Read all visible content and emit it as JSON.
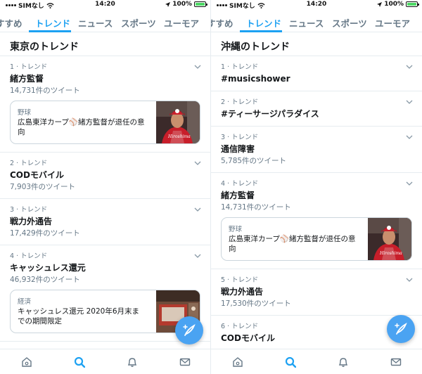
{
  "accent_color": "#1da1f2",
  "left": {
    "status": {
      "carrier": "SIMなし",
      "time": "14:20",
      "battery": "100%",
      "battery_level": 1.0
    },
    "tabs": [
      {
        "label": "すすめ",
        "active": false
      },
      {
        "label": "トレンド",
        "active": true
      },
      {
        "label": "ニュース",
        "active": false
      },
      {
        "label": "スポーツ",
        "active": false
      },
      {
        "label": "ユーモア",
        "active": false
      }
    ],
    "section_title": "東京のトレンド",
    "trends": [
      {
        "rank": "1 · トレンド",
        "name": "緒方監督",
        "count": "14,731件のツイート",
        "card": {
          "category": "野球",
          "text": "広島東洋カープ⚾️緒方監督が退任の意向"
        }
      },
      {
        "rank": "2 · トレンド",
        "name": "CODモバイル",
        "count": "7,903件のツイート"
      },
      {
        "rank": "3 · トレンド",
        "name": "戦力外通告",
        "count": "17,429件のツイート"
      },
      {
        "rank": "4 · トレンド",
        "name": "キャッシュレス還元",
        "count": "46,932件のツイート",
        "card": {
          "category": "経済",
          "text": "キャッシュレス還元 2020年6月末までの期間限定"
        }
      }
    ],
    "icons": [
      "home-icon",
      "search-icon",
      "bell-icon",
      "mail-icon",
      "compose-tweet-icon",
      "chevron-down-icon"
    ]
  },
  "right": {
    "status": {
      "carrier": "SIMなし",
      "time": "14:20",
      "battery": "100%",
      "battery_level": 1.0
    },
    "tabs": [
      {
        "label": "すすめ",
        "active": false
      },
      {
        "label": "トレンド",
        "active": true
      },
      {
        "label": "ニュース",
        "active": false
      },
      {
        "label": "スポーツ",
        "active": false
      },
      {
        "label": "ユーモア",
        "active": false
      }
    ],
    "section_title": "沖縄のトレンド",
    "trends": [
      {
        "rank": "1 · トレンド",
        "name": "#musicshower"
      },
      {
        "rank": "2 · トレンド",
        "name": "#ティーサージパラダイス"
      },
      {
        "rank": "3 · トレンド",
        "name": "通信障害",
        "count": "5,785件のツイート"
      },
      {
        "rank": "4 · トレンド",
        "name": "緒方監督",
        "count": "14,731件のツイート",
        "card": {
          "category": "野球",
          "text": "広島東洋カープ⚾️緒方監督が退任の意向"
        }
      },
      {
        "rank": "5 · トレンド",
        "name": "戦力外通告",
        "count": "17,530件のツイート"
      },
      {
        "rank": "6 · トレンド",
        "name": "CODモバイル"
      }
    ]
  }
}
